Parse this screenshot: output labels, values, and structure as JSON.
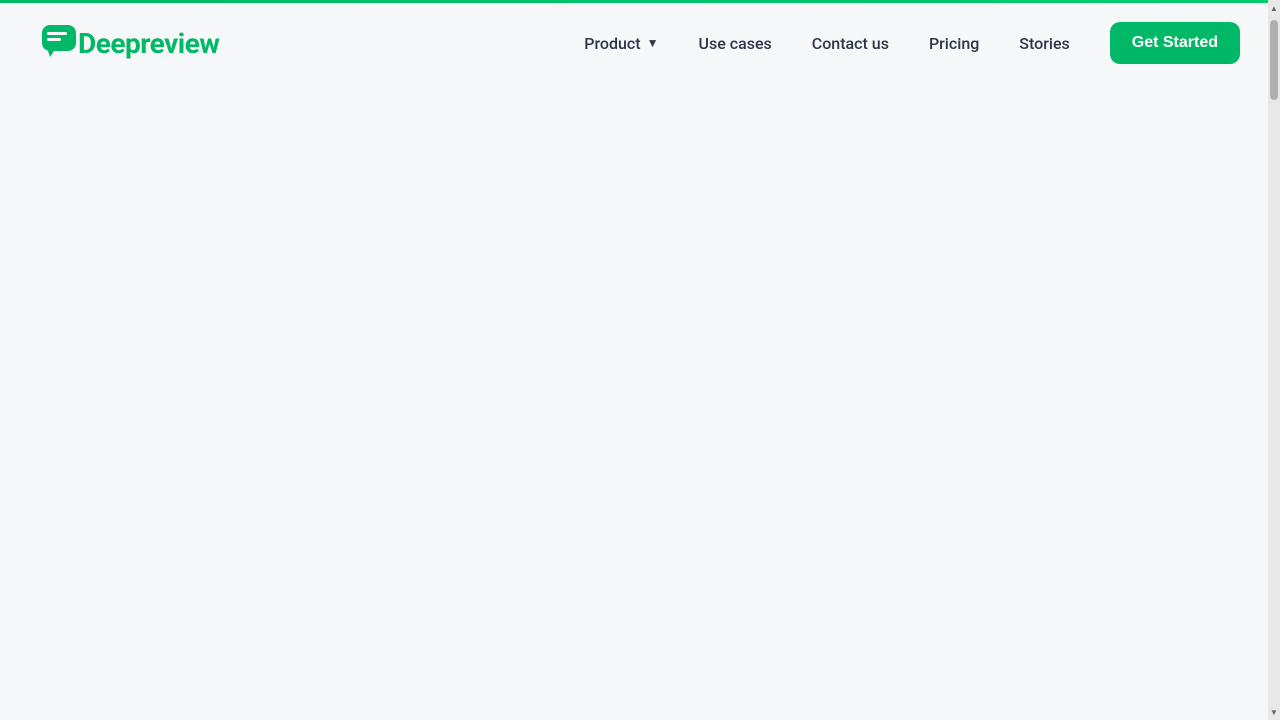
{
  "brand": {
    "name": "Deepreview",
    "logo_letter": "D",
    "color": "#00b865"
  },
  "nav": {
    "items": [
      {
        "label": "Product",
        "has_dropdown": true
      },
      {
        "label": "Use cases",
        "has_dropdown": false
      },
      {
        "label": "Contact us",
        "has_dropdown": false
      },
      {
        "label": "Pricing",
        "has_dropdown": false
      },
      {
        "label": "Stories",
        "has_dropdown": false
      }
    ],
    "cta_label": "Get Started"
  },
  "main": {
    "bg_color": "#f6f7f8"
  }
}
